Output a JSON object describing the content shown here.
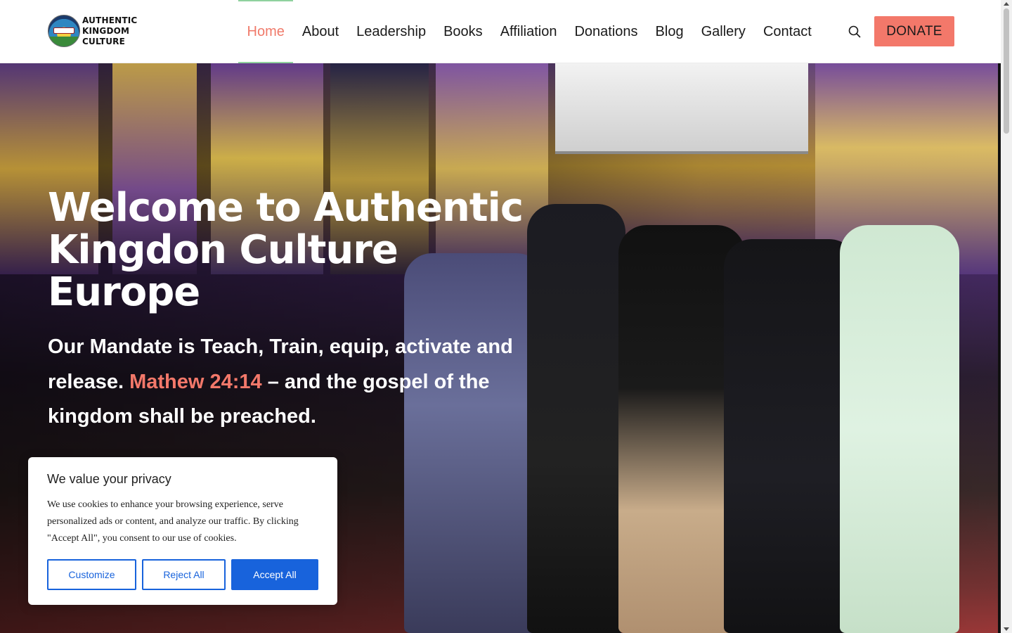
{
  "brand": {
    "logo_lines": [
      "AUTHENTIC",
      "KINGDOM",
      "CULTURE"
    ]
  },
  "nav": {
    "items": [
      {
        "label": "Home",
        "active": true
      },
      {
        "label": "About"
      },
      {
        "label": "Leadership"
      },
      {
        "label": "Books"
      },
      {
        "label": "Affiliation"
      },
      {
        "label": "Donations"
      },
      {
        "label": "Blog"
      },
      {
        "label": "Gallery"
      },
      {
        "label": "Contact"
      }
    ],
    "search_icon": "search-icon",
    "donate_label": "DONATE"
  },
  "hero": {
    "title": "Welcome to Authentic Kingdon Culture Europe",
    "subtitle_part1": "Our Mandate is  Teach, Train, equip, activate and release. ",
    "subtitle_verse": "Mathew 24:14",
    "subtitle_part2": " – and the gospel of the kingdom shall be preached."
  },
  "cookie": {
    "title": "We value your privacy",
    "text": "We use cookies to enhance your browsing experience, serve personalized ads or content, and analyze our traffic. By clicking \"Accept All\", you consent to our use of cookies.",
    "customize_label": "Customize",
    "reject_label": "Reject All",
    "accept_label": "Accept All"
  },
  "colors": {
    "accent": "#f3786a",
    "nav_active_line": "#8fd19e",
    "cookie_primary": "#1863dc"
  }
}
